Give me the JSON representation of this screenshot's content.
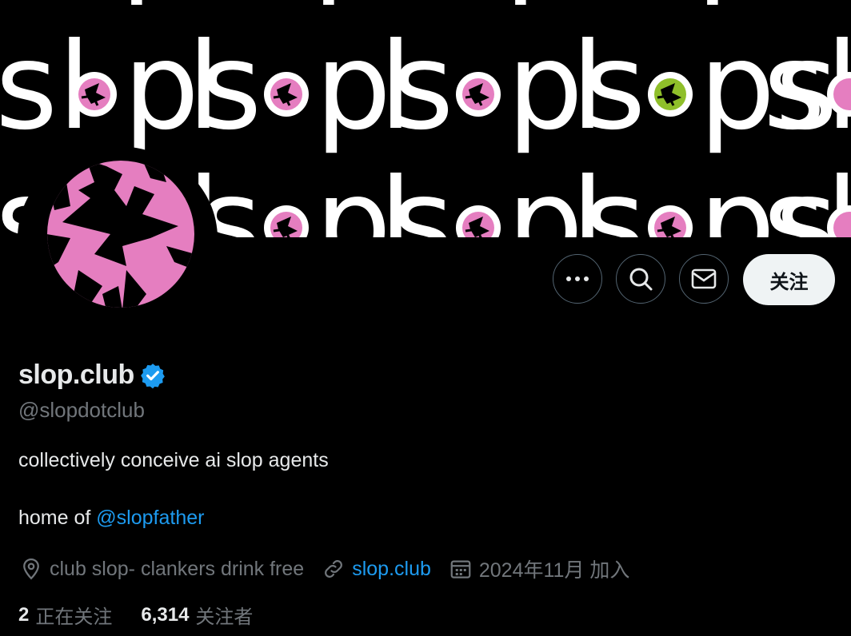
{
  "banner": {
    "wordmark": "slopslopslopslopslop",
    "row_top": "slopslopslopslopslopsl",
    "accent_pink": "#e57ec0",
    "accent_green": "#8fbf2a"
  },
  "actions": {
    "more_icon": "more-horizontal-icon",
    "search_icon": "search-icon",
    "message_icon": "mail-icon",
    "follow_label": "关注"
  },
  "profile": {
    "display_name": "slop.club",
    "verified": true,
    "handle": "@slopdotclub",
    "bio_line1": "collectively conceive ai slop agents",
    "bio_line2_prefix": "home of ",
    "bio_mention": "@slopfather",
    "location": "club slop- clankers drink free",
    "website": "slop.club",
    "joined": "2024年11月 加入"
  },
  "stats": {
    "following_count": "2",
    "following_label": "正在关注",
    "followers_count": "6,314",
    "followers_label": "关注者"
  },
  "colors": {
    "link": "#1d9bf0",
    "verified": "#1d9bf0",
    "muted": "#71767b"
  }
}
